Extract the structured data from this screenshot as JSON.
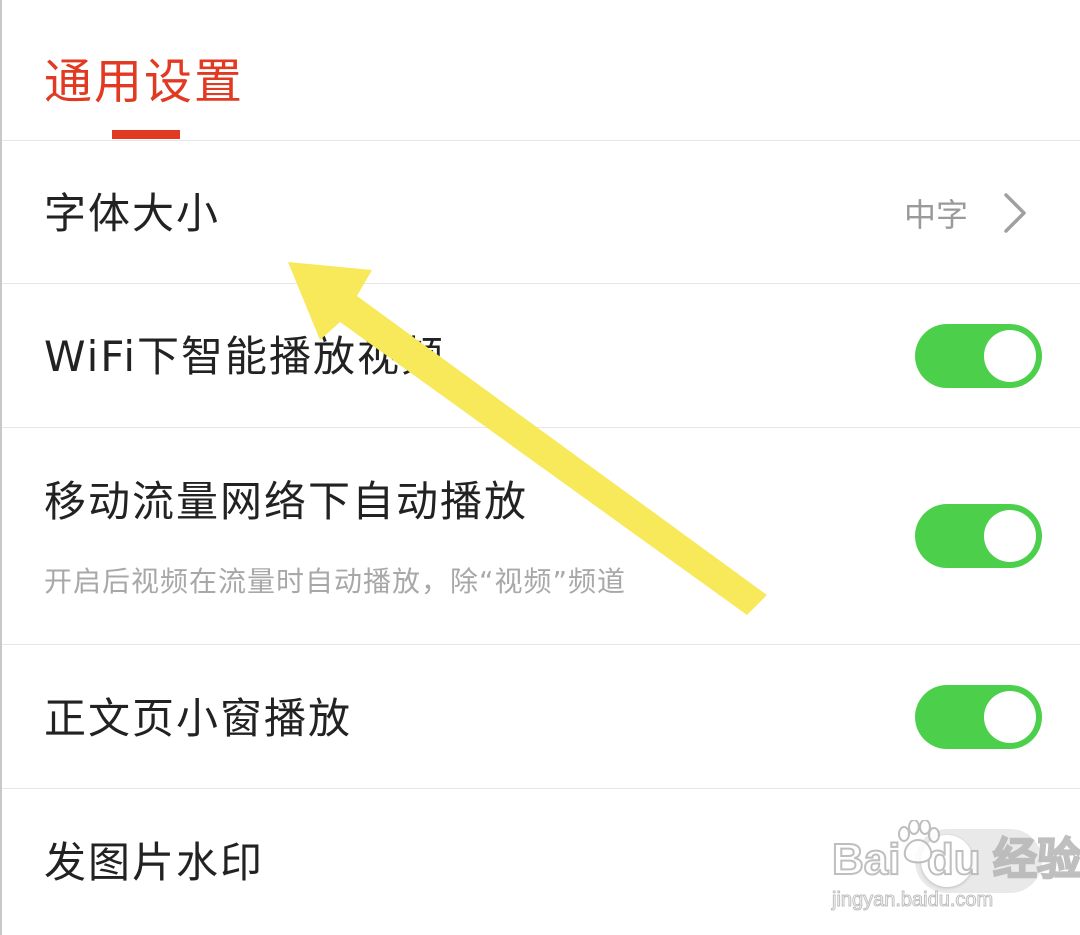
{
  "header": {
    "title": "通用设置"
  },
  "settings": [
    {
      "label": "字体大小",
      "value": "中字"
    },
    {
      "label": "WiFi下智能播放视频",
      "toggle_on": true
    },
    {
      "label": "移动流量网络下自动播放",
      "description": "开启后视频在流量时自动播放，除“视频”频道",
      "toggle_on": true
    },
    {
      "label": "正文页小窗播放",
      "toggle_on": true
    },
    {
      "label": "发图片水印",
      "toggle_on": false
    }
  ],
  "icons": {
    "chevron": "chevron-right-icon",
    "annotation": "yellow-arrow"
  },
  "colors": {
    "accent": "#e23a22",
    "toggle_on": "#4cd04b",
    "annotation_arrow": "#f7e95a"
  },
  "watermark": {
    "logo": "Bai du 经验",
    "url": "jingyan.baidu.com"
  }
}
